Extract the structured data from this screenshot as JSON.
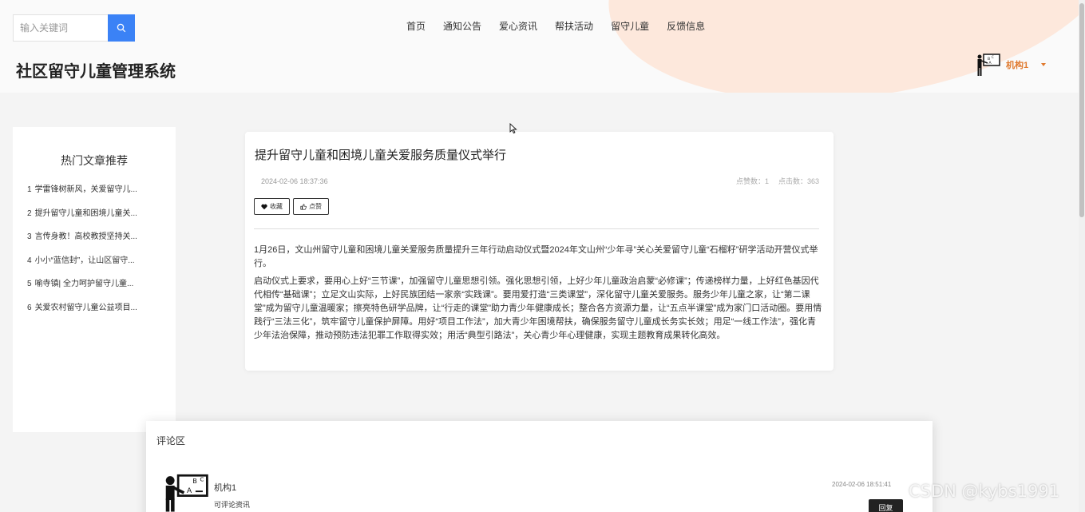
{
  "search": {
    "placeholder": "输入关键词"
  },
  "nav": {
    "items": [
      "首页",
      "通知公告",
      "爱心资讯",
      "帮扶活动",
      "留守儿童",
      "反馈信息"
    ]
  },
  "site_title": "社区留守儿童管理系统",
  "user": {
    "name": "机构1"
  },
  "sidebar": {
    "title": "热门文章推荐",
    "items": [
      {
        "index": "1",
        "title": "学雷锋树新风，关爱留守儿..."
      },
      {
        "index": "2",
        "title": "提升留守儿童和困境儿童关..."
      },
      {
        "index": "3",
        "title": "言传身教！高校教授坚持关..."
      },
      {
        "index": "4",
        "title": "小小“蓝信封”，让山区留守..."
      },
      {
        "index": "5",
        "title": "喻寺镇| 全力呵护留守儿童..."
      },
      {
        "index": "6",
        "title": "关爱农村留守儿童公益项目..."
      }
    ]
  },
  "article": {
    "title": "提升留守儿童和困境儿童关爱服务质量仪式举行",
    "date": "2024-02-06 18:37:36",
    "likes_label": "点赞数：1",
    "clicks_label": "点击数：363",
    "favorite_label": "收藏",
    "like_label": "点赞",
    "paragraphs": [
      "1月26日，文山州留守儿童和困境儿童关爱服务质量提升三年行动启动仪式暨2024年文山州“少年寻”关心关爱留守儿童“石榴籽”研学活动开营仪式举行。",
      "启动仪式上要求，要用心上好“三节课”，加强留守儿童思想引领。强化思想引领，上好少年儿童政治启蒙“必修课”；传递榜样力量，上好红色基因代代相传“基础课”；立足文山实际，上好民族团结一家亲“实践课”。要用爱打造“三类课堂”，深化留守儿童关爱服务。服务少年儿童之家，让“第二课堂”成为留守儿童温暖家；擦亮特色研学品牌，让“行走的课堂”助力青少年健康成长；整合各方资源力量，让“五点半课堂”成为家门口活动圈。要用情践行“三法三化”，筑牢留守儿童保护屏障。用好“项目工作法”，加大青少年困境帮扶，确保服务留守儿童成长务实长效；用足“一线工作法”，强化青少年法治保障，推动预防违法犯罪工作取得实效；用活“典型引路法”，关心青少年心理健康，实现主题教育成果转化高效。"
    ]
  },
  "comments": {
    "title": "评论区",
    "items": [
      {
        "author": "机构1",
        "text": "可评论资讯",
        "time": "2024-02-06 18:51:41",
        "reply_label": "回复"
      }
    ]
  },
  "watermark": "CSDN @kybs1991",
  "colors": {
    "accent_blue": "#3b82f6",
    "user_orange": "#e07a2f",
    "header_blob": "#fde8dc"
  },
  "icons": [
    "search-icon",
    "teacher-avatar-icon",
    "heart-icon",
    "thumb-up-icon",
    "caret-down-icon",
    "cursor-icon"
  ]
}
